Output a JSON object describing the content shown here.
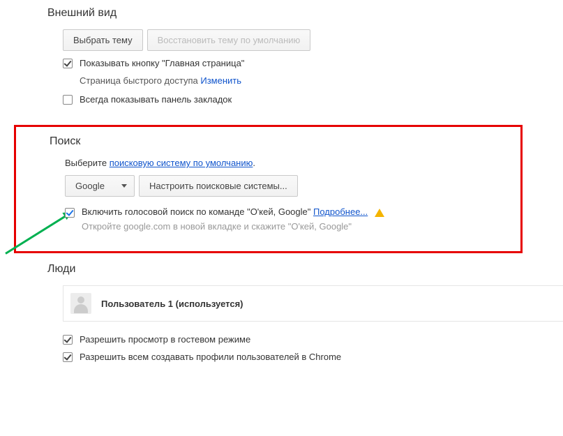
{
  "appearance": {
    "title": "Внешний вид",
    "choose_theme_btn": "Выбрать тему",
    "restore_theme_btn": "Восстановить тему по умолчанию",
    "show_home_checkbox": "Показывать кнопку \"Главная страница\"",
    "home_sub_label": "Страница быстрого доступа",
    "home_change_link": "Изменить",
    "show_bookmarks_checkbox": "Всегда показывать панель закладок"
  },
  "search": {
    "title": "Поиск",
    "prefix": "Выберите ",
    "default_engine_link": "поисковую систему по умолчанию",
    "suffix": ".",
    "engine_selected": "Google",
    "manage_engines_btn": "Настроить поисковые системы...",
    "voice_checkbox": "Включить голосовой поиск по команде \"О'кей, Google\"",
    "learn_more_link": "Подробнее...",
    "voice_sub": "Откройте google.com в новой вкладке и скажите \"О'кей, Google\""
  },
  "people": {
    "title": "Люди",
    "user_label": "Пользователь 1 (используется)",
    "guest_checkbox": "Разрешить просмотр в гостевом режиме",
    "allow_create_checkbox": "Разрешить всем создавать профили пользователей в Chrome"
  }
}
